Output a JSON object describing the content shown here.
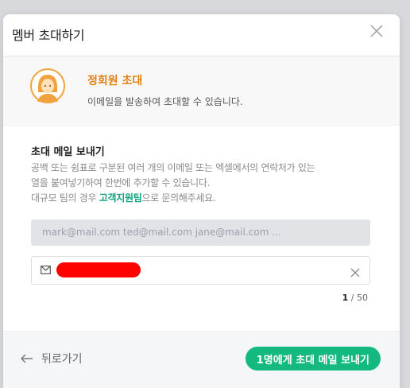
{
  "modal": {
    "title": "멤버 초대하기"
  },
  "promo": {
    "title": "정회원 초대",
    "description": "이메일을 발송하여 초대할 수 있습니다."
  },
  "invite": {
    "section_title": "초대 메일 보내기",
    "desc_line1": "공백 또는 쉼표로 구분된 여러 개의 이메일 또는 엑셀에서의 연락처가 있는",
    "desc_line2": "열을 붙여넣기하여 한번에 추가할 수 있습니다.",
    "desc_line3_pre": "대규모 팀의 경우 ",
    "desc_link": "고객지원팀",
    "desc_line3_post": "으로 문의해주세요.",
    "input_placeholder": "mark@mail.com ted@mail.com jane@mail.com ...",
    "count_current": "1",
    "count_sep": " / ",
    "count_max": "50"
  },
  "footer": {
    "back_label": "뒤로가기",
    "send_label": "1명에게 초대 메일 보내기"
  },
  "colors": {
    "accent": "#13b97f",
    "promo_title": "#e3800e",
    "redaction": "#ff0000"
  }
}
